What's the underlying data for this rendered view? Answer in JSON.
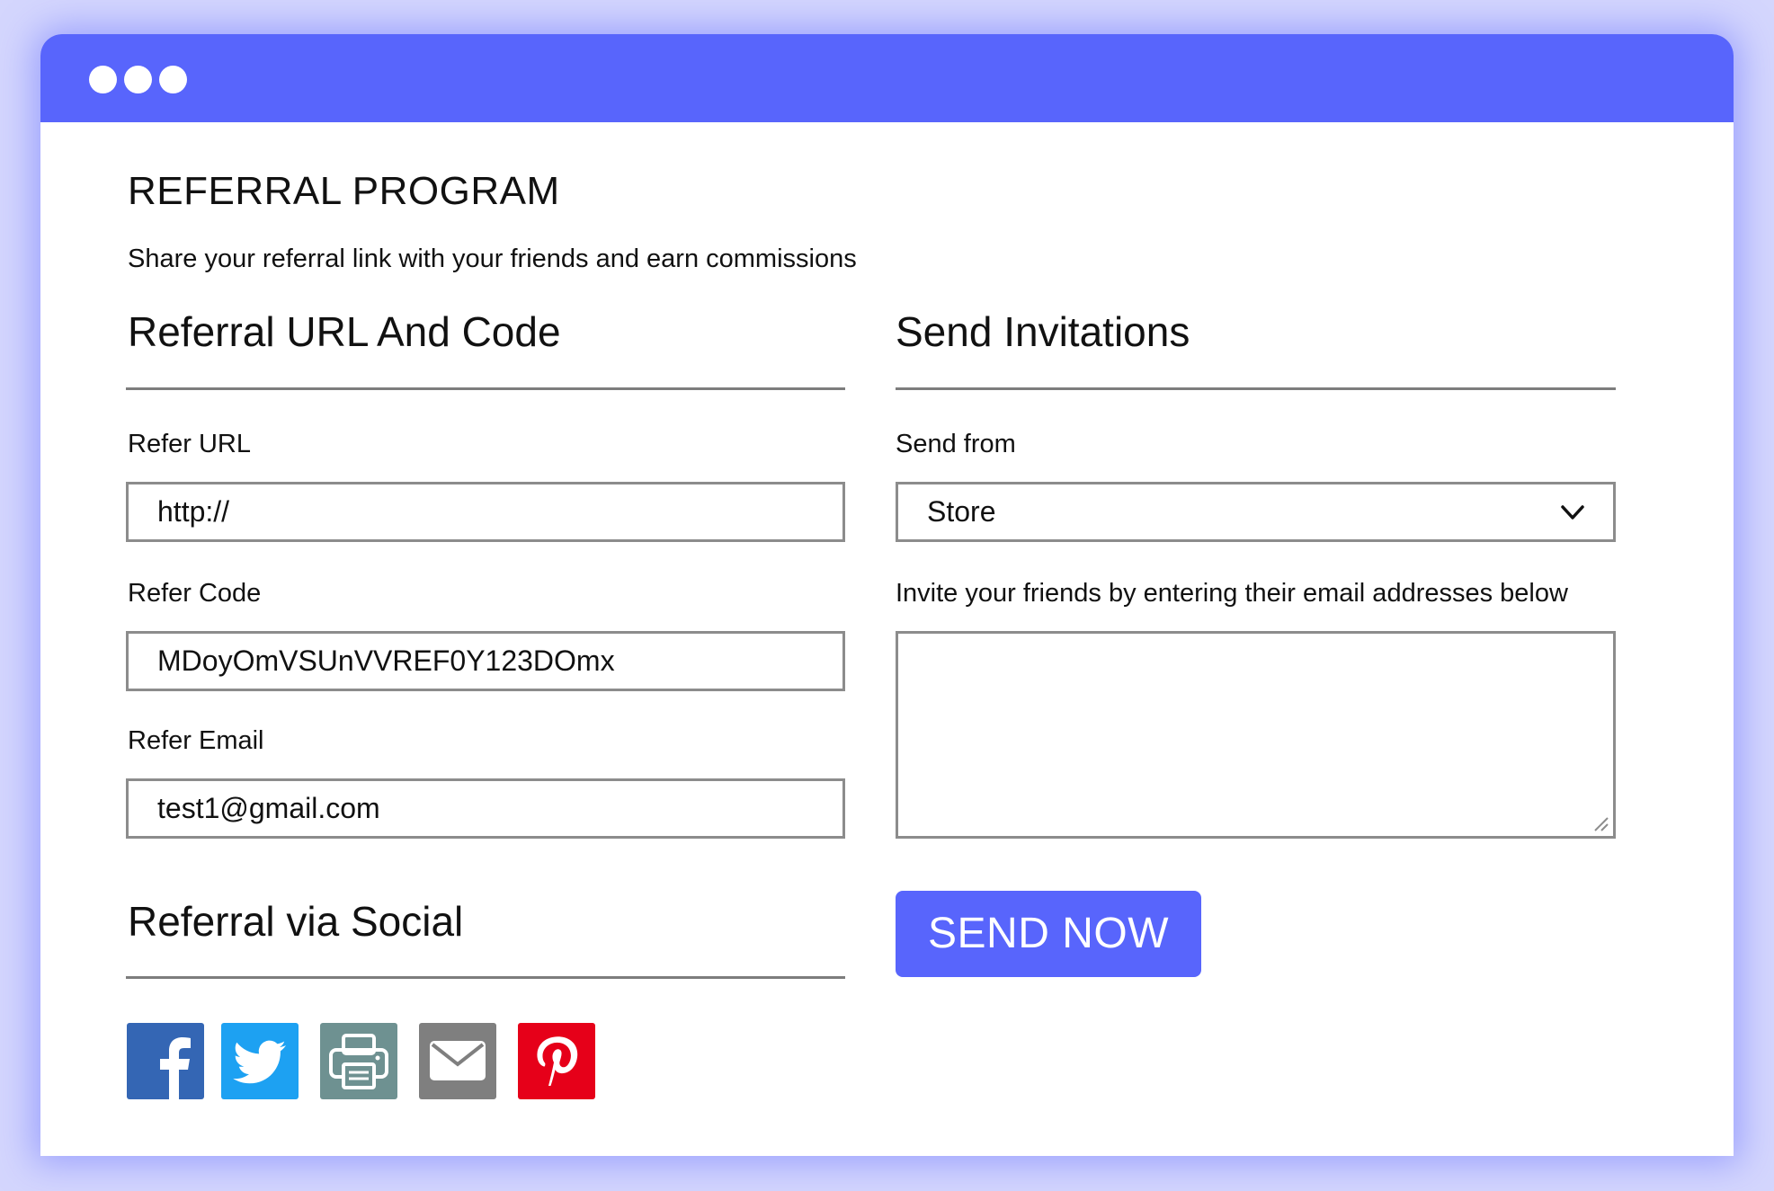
{
  "colors": {
    "accent": "#5865fc",
    "background": "#d4d6fd",
    "facebook": "#3466b4",
    "twitter": "#1da1f2",
    "print": "#6e9191",
    "email": "#7f7f7f",
    "pinterest": "#e60019"
  },
  "page": {
    "title": "REFERRAL PROGRAM",
    "subtitle": "Share your referral link with your friends and earn commissions"
  },
  "referral": {
    "heading": "Referral URL And Code",
    "url_label": "Refer URL",
    "url_value": "http://",
    "code_label": "Refer Code",
    "code_value": "MDoyOmVSUnVVREF0Y123DOmx",
    "email_label": "Refer Email",
    "email_value": "test1@gmail.com"
  },
  "invitations": {
    "heading": "Send Invitations",
    "send_from_label": "Send from",
    "send_from_selected": "Store",
    "emails_label": "Invite your friends by entering their email addresses below",
    "emails_value": "",
    "send_button": "SEND NOW"
  },
  "social": {
    "heading": "Referral via Social",
    "icons": [
      "facebook-icon",
      "twitter-icon",
      "print-icon",
      "email-icon",
      "pinterest-icon"
    ]
  }
}
